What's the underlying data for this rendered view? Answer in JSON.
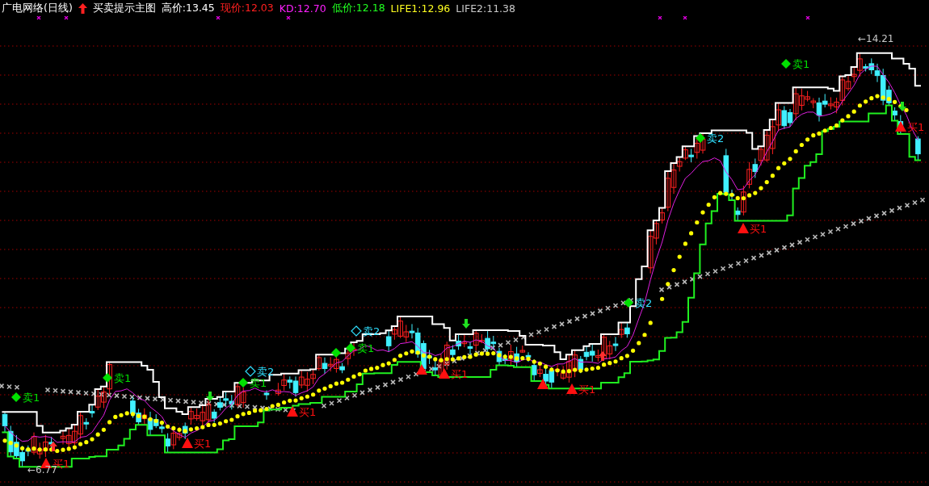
{
  "header": {
    "title": "广电网络(日线)",
    "indicator": "买卖提示主图",
    "readouts": [
      {
        "label": "高价:13.45",
        "color": "#ffffff"
      },
      {
        "label": "现价:12.03",
        "color": "#ff2020"
      },
      {
        "label": "KD:12.70",
        "color": "#ff20ff"
      },
      {
        "label": "低价:12.18",
        "color": "#20ff20"
      },
      {
        "label": "LIFE1:12.96",
        "color": "#ffff20"
      },
      {
        "label": "LIFE2:11.38",
        "color": "#c8c8c8"
      }
    ]
  },
  "extremes": [
    {
      "label": "←14.21"
    },
    {
      "label": "←6.77"
    }
  ],
  "signals": [
    {
      "kind": "sell",
      "label": "卖1"
    },
    {
      "kind": "buy",
      "label": "买1"
    },
    {
      "kind": "sell",
      "label": "卖1"
    },
    {
      "kind": "buy",
      "label": "买1"
    },
    {
      "kind": "sell-outline",
      "label": "卖2"
    },
    {
      "kind": "sell",
      "label": "卖1"
    },
    {
      "kind": "buy",
      "label": "买1"
    },
    {
      "kind": "sell",
      "label": "卖1"
    },
    {
      "kind": "sell-outline",
      "label": "卖2"
    },
    {
      "kind": "buy",
      "label": "买1"
    },
    {
      "kind": "buy",
      "label": "买1"
    },
    {
      "kind": "sell-solid",
      "label": "卖2"
    },
    {
      "kind": "sell-solid",
      "label": "卖2"
    },
    {
      "kind": "buy",
      "label": "买1"
    },
    {
      "kind": "sell",
      "label": "卖1"
    },
    {
      "kind": "buy",
      "label": "买1"
    }
  ]
}
